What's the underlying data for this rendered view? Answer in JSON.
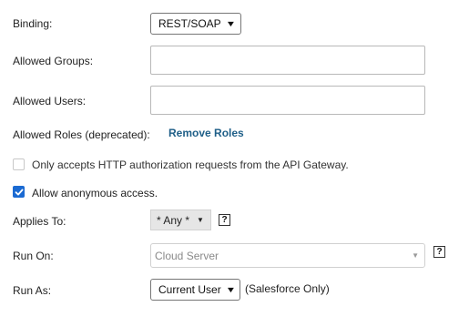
{
  "binding": {
    "label": "Binding:",
    "value": "REST/SOAP"
  },
  "allowed_groups": {
    "label": "Allowed Groups:",
    "value": ""
  },
  "allowed_users": {
    "label": "Allowed Users:",
    "value": ""
  },
  "allowed_roles": {
    "label": "Allowed Roles (deprecated):",
    "link": "Remove Roles"
  },
  "gateway_only": {
    "label": "Only accepts HTTP authorization requests from the API Gateway.",
    "checked": false
  },
  "anonymous": {
    "label": "Allow anonymous access.",
    "checked": true
  },
  "applies_to": {
    "label": "Applies To:",
    "value": "* Any *",
    "help": "?"
  },
  "run_on": {
    "label": "Run On:",
    "value": "Cloud Server",
    "help": "?"
  },
  "run_as": {
    "label": "Run As:",
    "value": "Current User",
    "note": "(Salesforce Only)"
  },
  "colors": {
    "link": "#1f5f88",
    "checkbox_checked": "#1b6ad2"
  }
}
